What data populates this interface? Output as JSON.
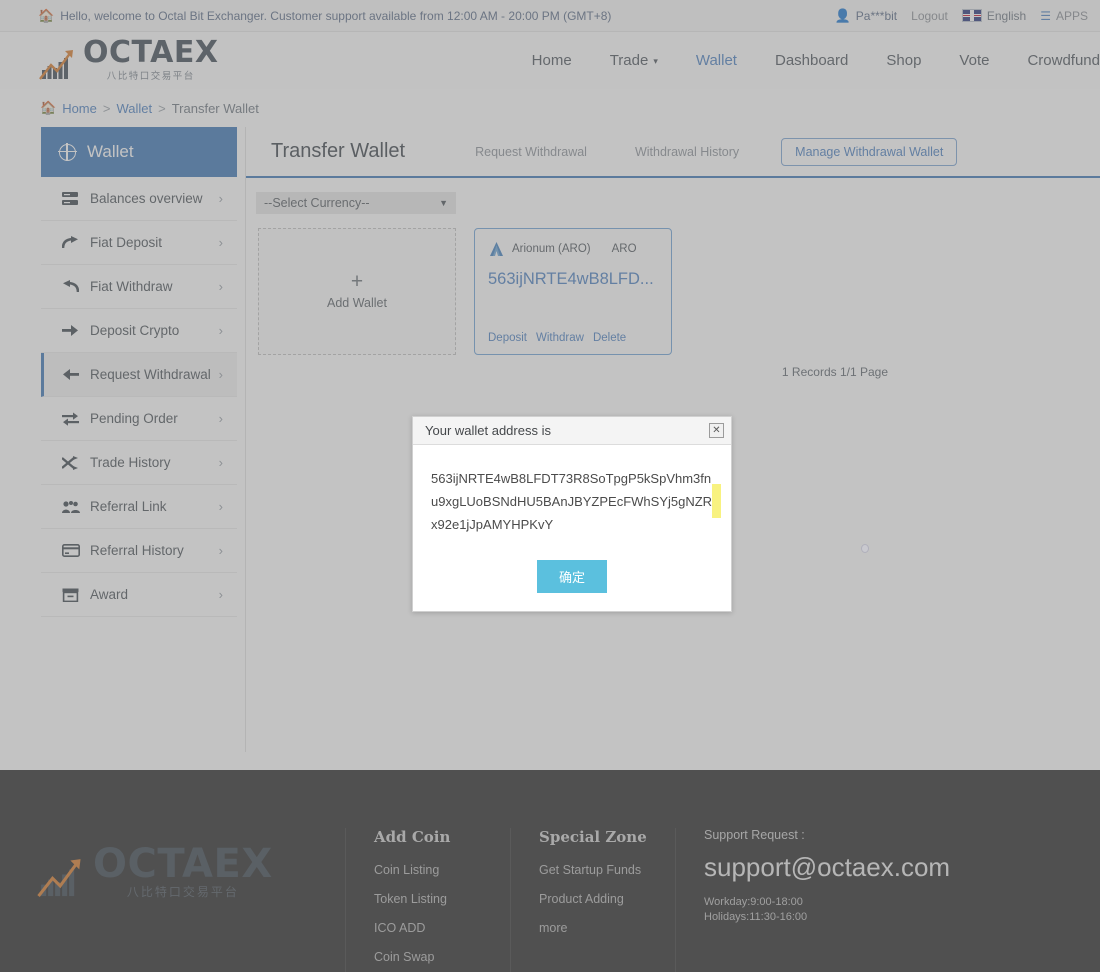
{
  "topbar": {
    "home_icon": "home-icon",
    "notice": "Hello, welcome to Octal Bit Exchanger. Customer support available from 12:00 AM - 20:00 PM (GMT+8)",
    "user_icon": "user-icon",
    "username": "Pa***bit",
    "logout": "Logout",
    "flag_icon": "uk-flag-icon",
    "language": "English",
    "apps_icon": "apps-list-icon",
    "apps": "APPS"
  },
  "brand": {
    "name": "OCTAEX",
    "subtitle": "八比特口交易平台",
    "logo_icon": "chart-arrow-logo-icon",
    "accent": "#d97b2a",
    "text_color": "#3f4a55"
  },
  "nav": {
    "items": [
      {
        "label": "Home",
        "active": false,
        "caret": false
      },
      {
        "label": "Trade",
        "active": false,
        "caret": true
      },
      {
        "label": "Wallet",
        "active": true,
        "caret": false
      },
      {
        "label": "Dashboard",
        "active": false,
        "caret": false
      },
      {
        "label": "Shop",
        "active": false,
        "caret": false
      },
      {
        "label": "Vote",
        "active": false,
        "caret": false
      },
      {
        "label": "Crowdfund",
        "active": false,
        "caret": false
      }
    ],
    "caret_glyph": "⌄"
  },
  "breadcrumb": {
    "home_icon": "home-icon",
    "home": "Home",
    "sep": ">",
    "wallet": "Wallet",
    "current": "Transfer Wallet"
  },
  "sidebar": {
    "title": "Wallet",
    "title_icon": "wallet-globe-icon",
    "chevron": "›",
    "items": [
      {
        "label": "Balances overview",
        "icon": "server-list-icon",
        "glyph": "▤",
        "active": false
      },
      {
        "label": "Fiat Deposit",
        "icon": "arrow-curve-right-icon",
        "glyph": "↱",
        "active": false
      },
      {
        "label": "Fiat Withdraw",
        "icon": "arrow-curve-left-icon",
        "glyph": "↰",
        "active": false
      },
      {
        "label": "Deposit Crypto",
        "icon": "arrow-right-icon",
        "glyph": "→",
        "active": false
      },
      {
        "label": "Request Withdrawal",
        "icon": "arrow-left-icon",
        "glyph": "←",
        "active": true
      },
      {
        "label": "Pending Order",
        "icon": "exchange-arrows-icon",
        "glyph": "⇄",
        "active": false
      },
      {
        "label": "Trade History",
        "icon": "shuffle-icon",
        "glyph": "⤫",
        "active": false
      },
      {
        "label": "Referral Link",
        "icon": "users-group-icon",
        "glyph": "👥",
        "active": false
      },
      {
        "label": "Referral History",
        "icon": "credit-card-icon",
        "glyph": "▭",
        "active": false
      },
      {
        "label": "Award",
        "icon": "archive-box-icon",
        "glyph": "▤",
        "active": false
      }
    ]
  },
  "main": {
    "title": "Transfer Wallet",
    "tabs": [
      {
        "label": "Request Withdrawal",
        "style": "plain"
      },
      {
        "label": "Withdrawal History",
        "style": "plain"
      },
      {
        "label": "Manage Withdrawal Wallet",
        "style": "pill"
      }
    ],
    "currency_select": {
      "value": "--Select Currency--",
      "arrow_icon": "chevron-down-icon"
    },
    "add_wallet": {
      "plus_icon": "plus-icon",
      "label": "Add Wallet"
    },
    "wallets": [
      {
        "coin_icon": "arionum-coin-icon",
        "name": "Arionum (ARO)",
        "symbol": "ARO",
        "address_short": "563ijNRTE4wB8LFD...",
        "actions": [
          "Deposit",
          "Withdraw",
          "Delete"
        ]
      }
    ],
    "records": "1 Records 1/1 Page"
  },
  "modal": {
    "title": "Your wallet address is",
    "close_icon": "close-icon",
    "close_glyph": "✕",
    "address": "563ijNRTE4wB8LFDT73R8SoTpgP5kSpVhm3fnu9xgLUoBSNdHU5BAnJBYZPEcFWhSYj5gNZRx92e1jJpAMYHPKvY",
    "ok_label": "确定",
    "ok_color": "#5bc0de"
  },
  "footer": {
    "brand": {
      "name": "OCTAEX",
      "subtitle": "八比特口交易平台"
    },
    "columns": [
      {
        "title": "Add Coin",
        "links": [
          "Coin Listing",
          "Token Listing",
          "ICO ADD",
          "Coin Swap"
        ]
      },
      {
        "title": "Special Zone",
        "links": [
          "Get Startup Funds",
          "Product Adding",
          "more"
        ]
      }
    ],
    "support": {
      "label": "Support Request :",
      "email": "support@octaex.com",
      "workday": "Workday:9:00-18:00",
      "holidays": "Holidays:11:30-16:00"
    }
  }
}
